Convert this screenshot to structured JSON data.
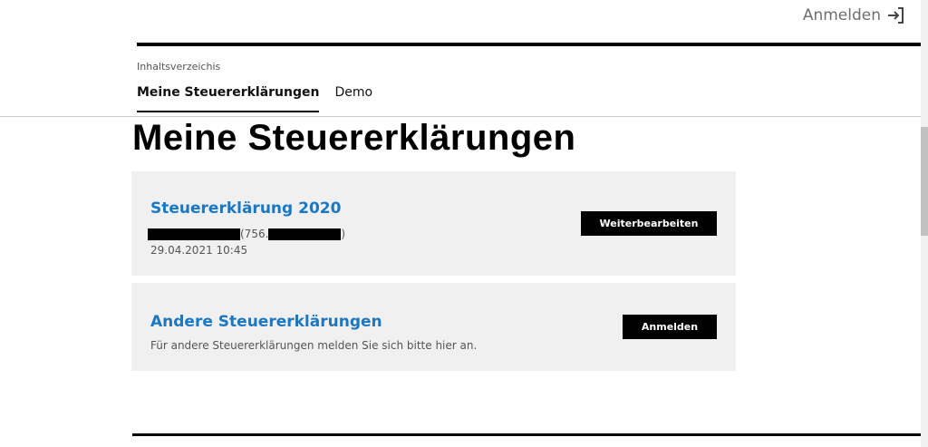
{
  "header": {
    "login_label": "Anmelden",
    "login_icon": "login-arrow-icon"
  },
  "nav": {
    "toc_label": "Inhaltsverzeichis",
    "tabs": [
      {
        "label": "Meine Steuererklärungen",
        "active": true
      },
      {
        "label": "Demo",
        "active": false
      }
    ]
  },
  "main": {
    "title": "Meine Steuererklärungen",
    "cards": [
      {
        "title": "Steuererklärung 2020",
        "id_prefix": "(756.",
        "id_suffix": ")",
        "date": "29.04.2021 10:45",
        "button_label": "Weiterbearbeiten"
      },
      {
        "title": "Andere Steuererklärungen",
        "description": "Für andere Steuererklärungen melden Sie sich bitte hier an.",
        "button_label": "Anmelden"
      }
    ]
  },
  "colors": {
    "accent_blue": "#1a78c2",
    "card_background": "#f0f0f0",
    "button_background": "#000000"
  }
}
